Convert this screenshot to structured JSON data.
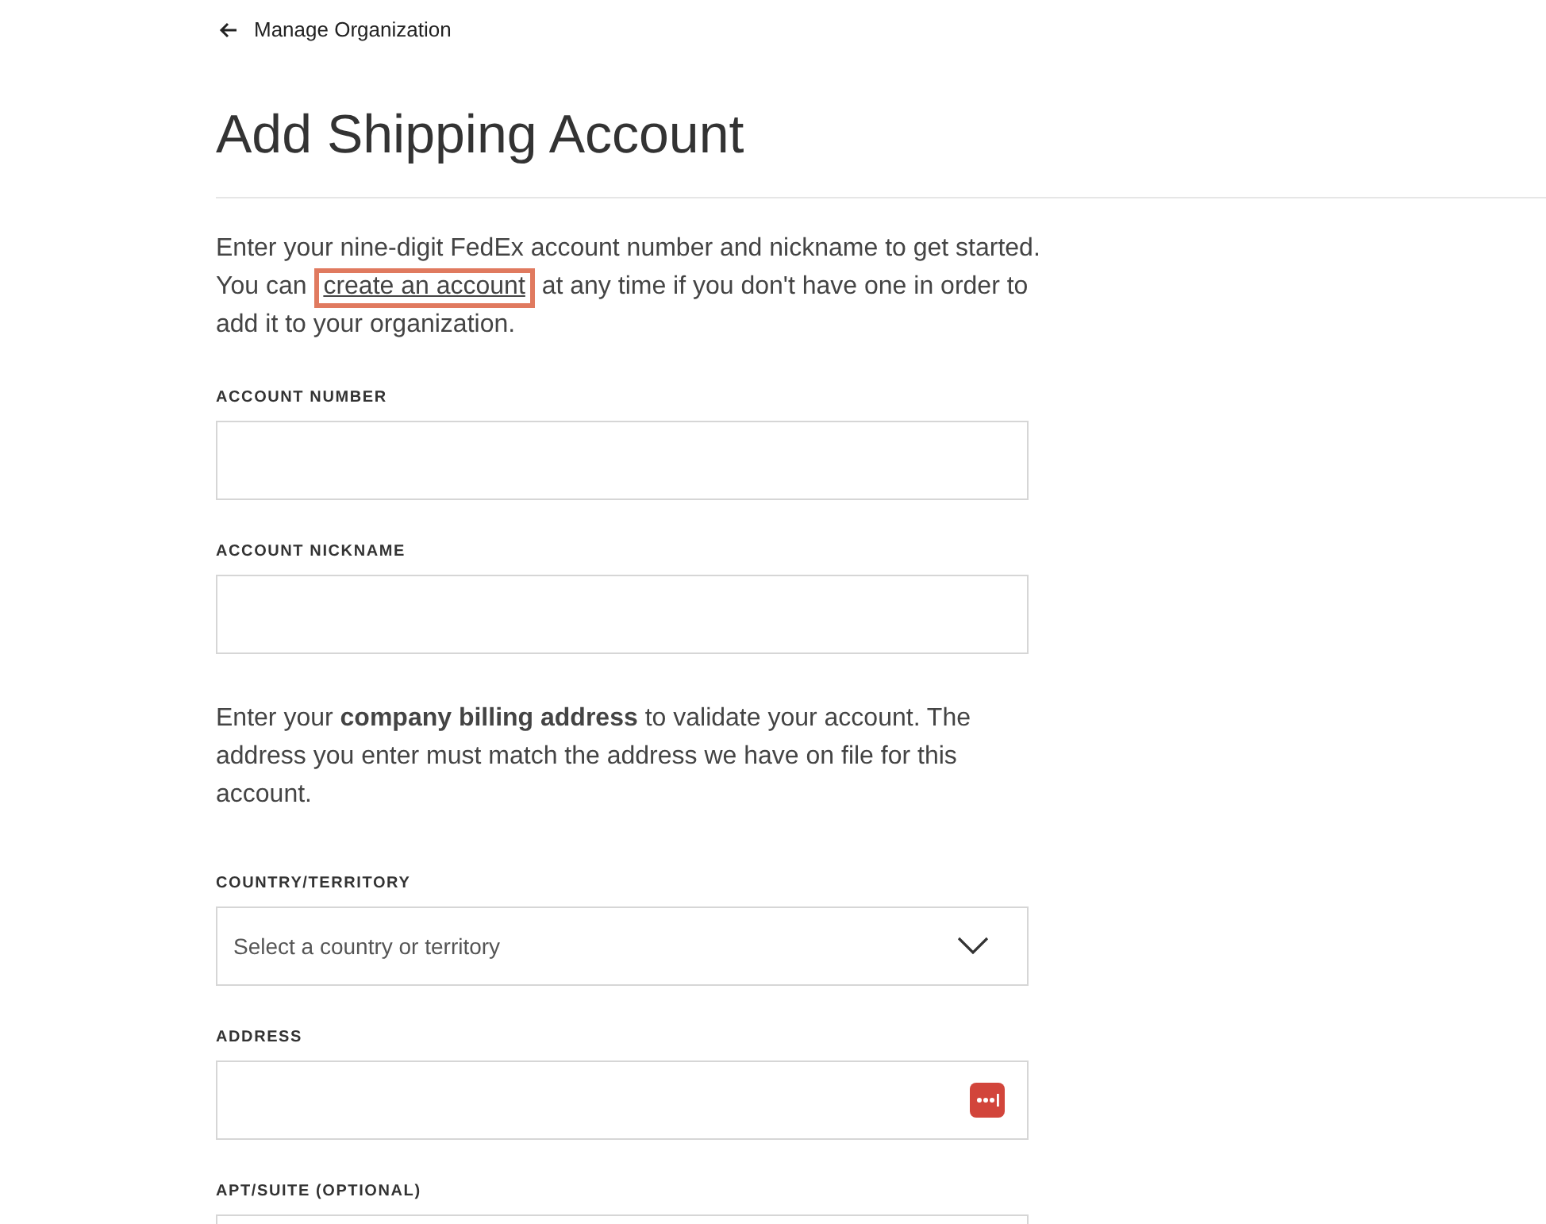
{
  "back_link": {
    "label": "Manage Organization"
  },
  "title": "Add Shipping Account",
  "intro": {
    "before": "Enter your nine-digit FedEx account number and nickname to get started. You can ",
    "link": "create an account",
    "after": " at any time if you don't have one in order to add it to your organization.",
    "highlighted": true
  },
  "fields": [
    {
      "kind": "text",
      "label": "ACCOUNT NUMBER"
    },
    {
      "kind": "text",
      "label": "ACCOUNT NICKNAME"
    }
  ],
  "billing_note": "Enter your **company billing address** to validate your account. The address you enter must match the address we have on file for this account.",
  "address_fields": [
    {
      "kind": "select",
      "label": "COUNTRY/TERRITORY",
      "placeholder": "Select a country or territory"
    },
    {
      "kind": "text",
      "label": "ADDRESS",
      "autofill_icon": true
    },
    {
      "kind": "text",
      "label": "APT/SUITE (OPTIONAL)"
    }
  ]
}
